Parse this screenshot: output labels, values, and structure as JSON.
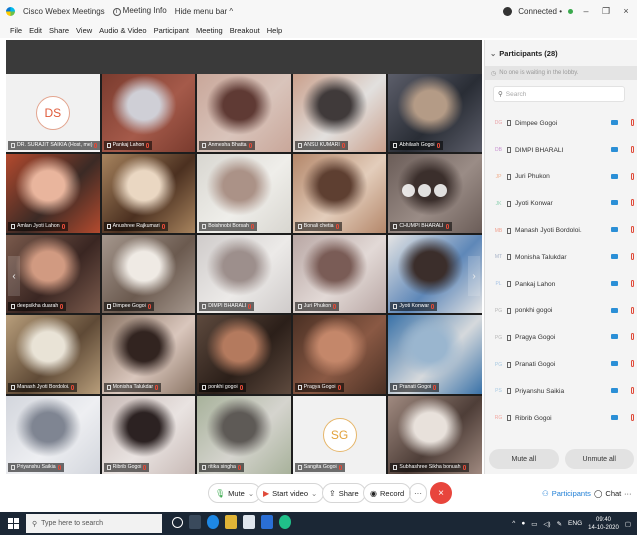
{
  "window": {
    "app_name": "Cisco Webex Meetings",
    "meeting_info": "Meeting Info",
    "hide_menu": "Hide menu bar ^",
    "status": "Connected •",
    "min": "–",
    "restore": "❐",
    "close": "×"
  },
  "menu": [
    "File",
    "Edit",
    "Share",
    "View",
    "Audio & Video",
    "Participant",
    "Meeting",
    "Breakout",
    "Help"
  ],
  "tiles": [
    {
      "name": "DR. SURAJIT SAIKIA (Host, me)",
      "avatar": "DS",
      "type": "avatar"
    },
    {
      "name": "Pankaj Lahon",
      "colors": [
        "#7a3b2e",
        "#cfcfd6",
        "#a55a4a"
      ]
    },
    {
      "name": "Anmesha Bhatta",
      "colors": [
        "#c9a79a",
        "#5f3a34",
        "#d9c4bb"
      ]
    },
    {
      "name": "ANSU KUMARI",
      "colors": [
        "#caa08c",
        "#403a3a",
        "#e2e0de"
      ]
    },
    {
      "name": "Abhilash Gogoi",
      "colors": [
        "#5c5e6a",
        "#b49b86",
        "#292d35"
      ]
    },
    {
      "name": "Amlan Jyoti Lahon",
      "colors": [
        "#b44a2e",
        "#e9b59d",
        "#3b2a25"
      ]
    },
    {
      "name": "Anushree Rajkumari",
      "colors": [
        "#a8845e",
        "#ead7c2",
        "#4b3020"
      ]
    },
    {
      "name": "Boishnobi Borsah",
      "colors": [
        "#d8d6d0",
        "#ab9287",
        "#efeeea"
      ]
    },
    {
      "name": "Bonali chetia",
      "colors": [
        "#b4876a",
        "#5e3f31",
        "#e3cdbb"
      ]
    },
    {
      "name": "CHUMPI BHARALI",
      "colors": [
        "#6b5d58",
        "#3b2f2c",
        "#9a8c86"
      ]
    },
    {
      "name": "deepsikha duarah",
      "colors": [
        "#7a5a4c",
        "#d19a81",
        "#3a2622"
      ]
    },
    {
      "name": "Dimpee Gogoi",
      "colors": [
        "#a5978d",
        "#efeae4",
        "#6b5a4f"
      ]
    },
    {
      "name": "DIMPI BHARALI",
      "colors": [
        "#cfcbca",
        "#9d8f8c",
        "#eceae8"
      ]
    },
    {
      "name": "Juri Phukon",
      "colors": [
        "#b9a7a4",
        "#7a5c56",
        "#e2d9d6"
      ]
    },
    {
      "name": "Jyoti Konwar",
      "colors": [
        "#e4e4e4",
        "#3b2e2b",
        "#5e87b8"
      ]
    },
    {
      "name": "Manash Jyoti Bordoloi.",
      "colors": [
        "#b89e7b",
        "#e9e3d6",
        "#5f4a36"
      ]
    },
    {
      "name": "Monisha Talukdar",
      "colors": [
        "#8c7666",
        "#322420",
        "#d9c6bc"
      ]
    },
    {
      "name": "ponkhi gogoi",
      "colors": [
        "#5e4a3e",
        "#b47a5e",
        "#2b1f19"
      ]
    },
    {
      "name": "Pragya Gogoi",
      "colors": [
        "#4a3024",
        "#c4876a",
        "#8a5944"
      ]
    },
    {
      "name": "Pranati Gogoi",
      "colors": [
        "#3a72a8",
        "#9ab6cf",
        "#d6d9dc"
      ]
    },
    {
      "name": "Priyanshu Saikia",
      "colors": [
        "#d3d6dd",
        "#7f8592",
        "#eeeff2"
      ]
    },
    {
      "name": "Ribrib Gogoi",
      "colors": [
        "#c8bab6",
        "#2c2222",
        "#e9e3e1"
      ]
    },
    {
      "name": "ritika singha",
      "colors": [
        "#a8b29b",
        "#5e5a56",
        "#d5d4ce"
      ]
    },
    {
      "name": "Sangita Gogoi",
      "avatar": "SG",
      "type": "avatar"
    },
    {
      "name": "Subhashree Sikha bonuah",
      "colors": [
        "#a08a80",
        "#e8e1db",
        "#4e3e38"
      ]
    }
  ],
  "toolbar": {
    "mute": "Mute",
    "start_video": "Start video",
    "share": "Share",
    "record": "Record",
    "more": "···",
    "end": "×",
    "participants": "Participants",
    "chat": "Chat",
    "right_more": "···"
  },
  "panel": {
    "title": "Participants (28)",
    "waiting": "No one is waiting in the lobby.",
    "search_placeholder": "Search",
    "mute_all": "Mute all",
    "unmute_all": "Unmute all",
    "participants": [
      {
        "initials": "DG",
        "name": "Dimpee Gogoi",
        "color": "#e9a0a6"
      },
      {
        "initials": "DB",
        "name": "DIMPI BHARALI",
        "color": "#c68fd0"
      },
      {
        "initials": "JP",
        "name": "Juri Phukon",
        "color": "#f1b08f"
      },
      {
        "initials": "JK",
        "name": "Jyoti Konwar",
        "color": "#8fd1b2"
      },
      {
        "initials": "MB",
        "name": "Manash Jyoti Bordoloi.",
        "color": "#f0a090"
      },
      {
        "initials": "MT",
        "name": "Monisha Talukdar",
        "color": "#a7b3c7"
      },
      {
        "initials": "PL",
        "name": "Pankaj Lahon",
        "color": "#a7c3e6"
      },
      {
        "initials": "PG",
        "name": "ponkhi gogoi",
        "color": "#b7b7b7"
      },
      {
        "initials": "PG",
        "name": "Pragya Gogoi",
        "color": "#b7b7b7"
      },
      {
        "initials": "PG",
        "name": "Pranati Gogoi",
        "color": "#a7c9e2"
      },
      {
        "initials": "PS",
        "name": "Priyanshu Saikia",
        "color": "#a7c9e2"
      },
      {
        "initials": "RG",
        "name": "Ribrib Gogoi",
        "color": "#f2a7a0"
      }
    ]
  },
  "taskbar": {
    "search_placeholder": "Type here to search",
    "lang": "ENG",
    "time": "09:40",
    "date": "14-10-2020"
  }
}
